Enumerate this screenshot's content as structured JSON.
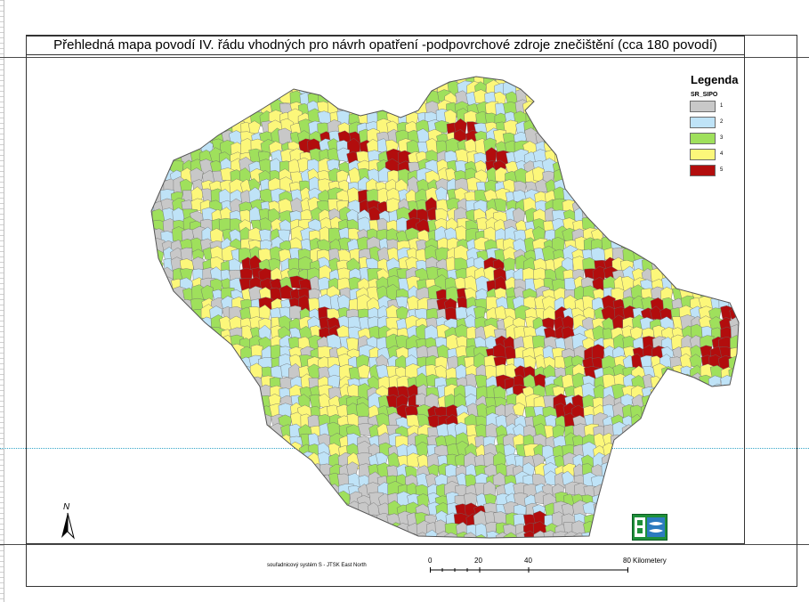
{
  "title": "Přehledná mapa povodí IV. řádu vhodných pro návrh opatření -podpovrchové zdroje znečištění (cca 180 povodí)",
  "legend": {
    "title": "Legenda",
    "field": "SR_SIPO",
    "items": [
      {
        "label": "1",
        "color": "#c8c8c8",
        "icon": "gray-swatch"
      },
      {
        "label": "2",
        "color": "#bfe3f7",
        "icon": "light-blue-swatch"
      },
      {
        "label": "3",
        "color": "#9fe05c",
        "icon": "green-swatch"
      },
      {
        "label": "4",
        "color": "#fcf77a",
        "icon": "yellow-swatch"
      },
      {
        "label": "5",
        "color": "#b20d0d",
        "icon": "red-swatch"
      }
    ]
  },
  "north_arrow": {
    "letter": "N",
    "icon": "north-arrow-icon"
  },
  "coordinate_system": "souřadnicový systém S - JTSK East North",
  "scale": {
    "ticks": [
      "0",
      "20",
      "40",
      "80"
    ],
    "unit": "Kilometery"
  },
  "logo": {
    "icon": "organisation-logo"
  }
}
